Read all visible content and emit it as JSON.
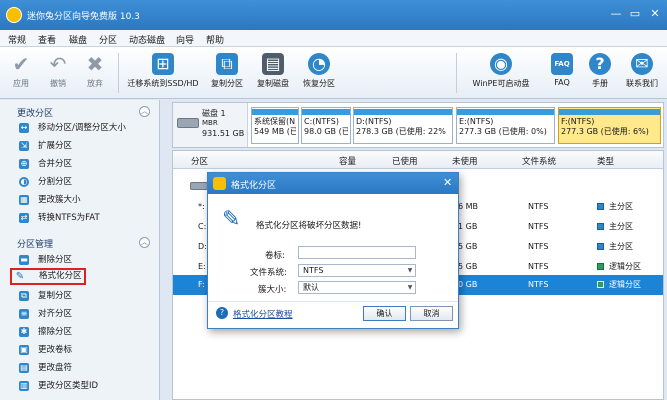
{
  "app": {
    "title": "迷你兔分区向导免费版 10.3"
  },
  "menu": [
    "常规",
    "查看",
    "磁盘",
    "分区",
    "动态磁盘",
    "向导",
    "帮助"
  ],
  "toolbar": {
    "apply": "应用",
    "undo": "撤销",
    "discard": "放弃",
    "migrate": "迁移系统到SSD/HD",
    "copy_partition": "复制分区",
    "copy_disk": "复制磁盘",
    "recover_partition": "恢复分区",
    "winpe": "WinPE可启动盘",
    "faq": "FAQ",
    "manual": "手册",
    "contact": "联系我们",
    "faq_icon_text": "FAQ"
  },
  "sidebar": {
    "section1": "更改分区",
    "items1": [
      "移动分区/调整分区大小",
      "扩展分区",
      "合并分区",
      "分割分区",
      "更改簇大小",
      "转换NTFS为FAT"
    ],
    "section2": "分区管理",
    "items2": [
      "删除分区",
      "格式化分区",
      "复制分区",
      "对齐分区",
      "擦除分区",
      "更改卷标",
      "更改盘符",
      "更改分区类型ID"
    ]
  },
  "diskmap": {
    "disk": {
      "name": "磁盘 1",
      "type": "MBR",
      "size": "931.51 GB"
    },
    "partitions": [
      {
        "name": "系统保留(N",
        "detail": "549 MB (已"
      },
      {
        "name": "C:(NTFS)",
        "detail": "98.0 GB (已"
      },
      {
        "name": "D:(NTFS)",
        "detail": "278.3 GB (已使用: 22%"
      },
      {
        "name": "E:(NTFS)",
        "detail": "277.3 GB (已使用: 0%)"
      },
      {
        "name": "F:(NTFS)",
        "detail": "277.3 GB (已使用: 6%)"
      }
    ]
  },
  "table": {
    "headers": [
      "分区",
      "容量",
      "已使用",
      "未使用",
      "文件系统",
      "类型"
    ],
    "rows": [
      {
        "name": "*:",
        "unused": "6 MB",
        "fs": "NTFS",
        "type": "主分区"
      },
      {
        "name": "C:",
        "unused": "1 GB",
        "fs": "NTFS",
        "type": "主分区"
      },
      {
        "name": "D:",
        "unused": "5 GB",
        "fs": "NTFS",
        "type": "主分区"
      },
      {
        "name": "E:",
        "unused": "5 GB",
        "fs": "NTFS",
        "type": "逻辑分区"
      },
      {
        "name": "F:",
        "unused": "0 GB",
        "fs": "NTFS",
        "type": "逻辑分区"
      }
    ]
  },
  "dialog": {
    "title": "格式化分区",
    "warning": "格式化分区将破坏分区数据!",
    "label_volume": "卷标:",
    "label_fs": "文件系统:",
    "label_cluster": "簇大小:",
    "volume_value": "",
    "fs_value": "NTFS",
    "cluster_value": "默认",
    "help_link": "格式化分区教程",
    "ok": "确认",
    "cancel": "取消"
  },
  "colors": {
    "titlebar": "#2b78c2",
    "selection": "#1c84d6",
    "selected_partition": "#ffe98a",
    "highlight_border": "#e0201e"
  }
}
